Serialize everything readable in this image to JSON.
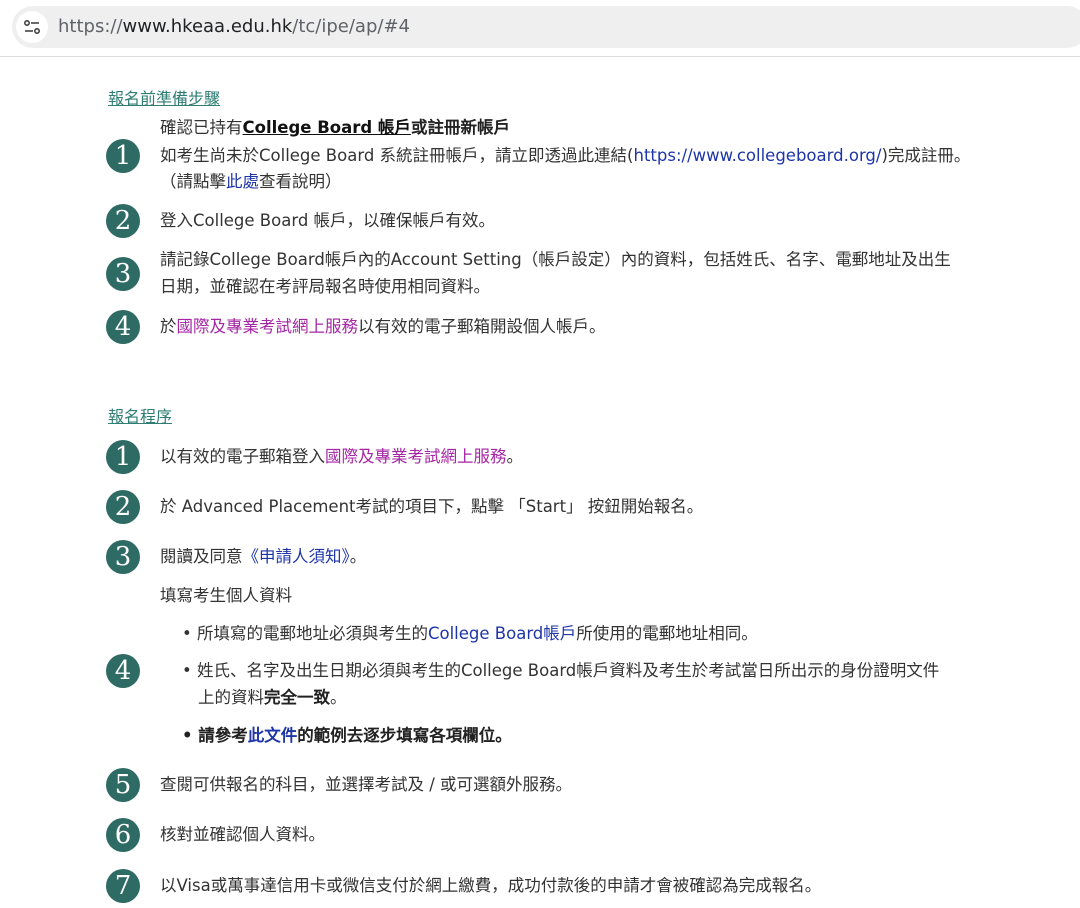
{
  "browser": {
    "url_prefix": "https://",
    "url_host": "www.hkeaa.edu.hk",
    "url_path": "/tc/ipe/ap/#4"
  },
  "section1": {
    "title": "報名前準備步驟",
    "step1": {
      "number": "1",
      "line1_prefix": "確認已持有",
      "line1_bold": "College Board 帳戶",
      "line1_suffix": "或註冊新帳戶",
      "line2_prefix": "如考生尚未於College Board 系統註冊帳戶，請立即透過此連結(",
      "line2_link": "https://www.collegeboard.org/",
      "line2_suffix": ")完成註冊。",
      "line3_prefix": "（請點擊",
      "line3_link": "此處",
      "line3_suffix": "查看說明）"
    },
    "step2": {
      "number": "2",
      "text": "登入College Board 帳戶，以確保帳戶有效。"
    },
    "step3": {
      "number": "3",
      "line1": "請記錄College Board帳戶內的Account Setting（帳戶設定）內的資料，包括姓氏、名字、電郵地址及出生",
      "line2": "日期，並確認在考評局報名時使用相同資料。"
    },
    "step4": {
      "number": "4",
      "prefix": "於",
      "link": "國際及專業考試網上服務",
      "suffix": "以有效的電子郵箱開設個人帳戶。"
    }
  },
  "section2": {
    "title": "報名程序",
    "step1": {
      "number": "1",
      "prefix": "以有效的電子郵箱登入",
      "link": "國際及專業考試網上服務",
      "suffix": "。"
    },
    "step2": {
      "number": "2",
      "text": "於 Advanced Placement考試的項目下，點擊 「Start」 按鈕開始報名。"
    },
    "step3": {
      "number": "3",
      "prefix": "閱讀及同意",
      "link": "《申請人須知》",
      "suffix": "。"
    },
    "step4": {
      "number": "4",
      "heading": "填寫考生個人資料",
      "bullet1_prefix": "所填寫的電郵地址必須與考生的",
      "bullet1_link": "College Board帳戶",
      "bullet1_suffix": "所使用的電郵地址相同。",
      "bullet2_line1": "姓氏、名字及出生日期必須與考生的College Board帳戶資料及考生於考試當日所出示的身份證明文件",
      "bullet2_line2_prefix": "上的資料",
      "bullet2_line2_bold": "完全一致",
      "bullet2_line2_suffix": "。",
      "bullet3_prefix": "請參考",
      "bullet3_link": "此文件",
      "bullet3_suffix": "的範例去逐步填寫各項欄位。"
    },
    "step5": {
      "number": "5",
      "text": "查閱可供報名的科目，並選擇考試及 / 或可選額外服務。"
    },
    "step6": {
      "number": "6",
      "text": "核對並確認個人資料。"
    },
    "step7": {
      "number": "7",
      "text": "以Visa或萬事達信用卡或微信支付於網上繳費，成功付款後的申請才會被確認為完成報名。"
    }
  },
  "colors": {
    "accent_teal": "#2e6b64",
    "section_title": "#2f7d73",
    "link_blue": "#1e35a8",
    "link_purple": "#a526a5"
  }
}
